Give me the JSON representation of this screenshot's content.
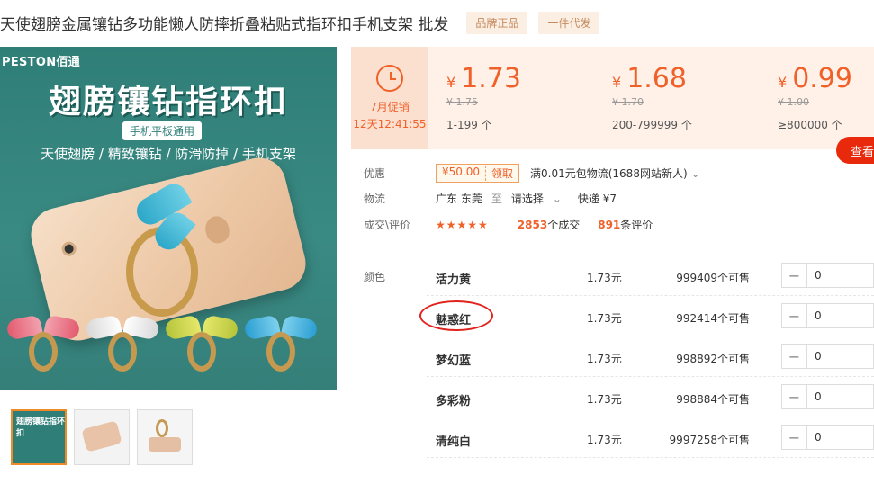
{
  "title": "天使翅膀金属镶钻多功能懒人防摔折叠粘贴式指环扣手机支架 批发",
  "tags": [
    "品牌正品",
    "一件代发"
  ],
  "image": {
    "brand_en": "PESTON",
    "brand_cn": "佰通",
    "headline": "翅膀镶钻指环扣",
    "pill": "手机平板通用",
    "features": "天使翅膀 / 精致镶钻 / 防滑防掉 / 手机支架",
    "thumb1_text": "翅膀镶钻指环扣"
  },
  "promo": {
    "label": "7月促销",
    "time": "12天12:41:55",
    "icon": "alarm-clock-icon",
    "color": "#f0612a"
  },
  "tiers": [
    {
      "currency": "¥",
      "price": "1.73",
      "old": "¥ 1.75",
      "range": "1-199 个"
    },
    {
      "currency": "¥",
      "price": "1.68",
      "old": "¥ 1.70",
      "range": "200-799999 个"
    },
    {
      "currency": "¥",
      "price": "0.99",
      "old": "¥ 1.00",
      "range": "≥800000 个"
    }
  ],
  "view_button": "查看",
  "discount": {
    "label": "优惠",
    "coupon_value": "¥50.00",
    "coupon_action": "领取",
    "text": "满0.01元包物流(1688网站新人)"
  },
  "logistics": {
    "label": "物流",
    "from": "广东 东莞",
    "to_word": "至",
    "select": "请选择",
    "express": "快递 ¥7"
  },
  "deals": {
    "label": "成交\\评价",
    "stars": "★★★★★",
    "count": "2853",
    "count_suffix": "个成交",
    "reviews": "891",
    "reviews_suffix": "条评价"
  },
  "sku": {
    "label": "颜色",
    "items": [
      {
        "name": "活力黄",
        "price": "1.73元",
        "stock": "999409个可售",
        "qty": "0"
      },
      {
        "name": "魅惑红",
        "price": "1.73元",
        "stock": "992414个可售",
        "qty": "0"
      },
      {
        "name": "梦幻蓝",
        "price": "1.73元",
        "stock": "998892个可售",
        "qty": "0"
      },
      {
        "name": "多彩粉",
        "price": "1.73元",
        "stock": "998884个可售",
        "qty": "0"
      },
      {
        "name": "清纯白",
        "price": "1.73元",
        "stock": "9997258个可售",
        "qty": "0"
      }
    ]
  }
}
